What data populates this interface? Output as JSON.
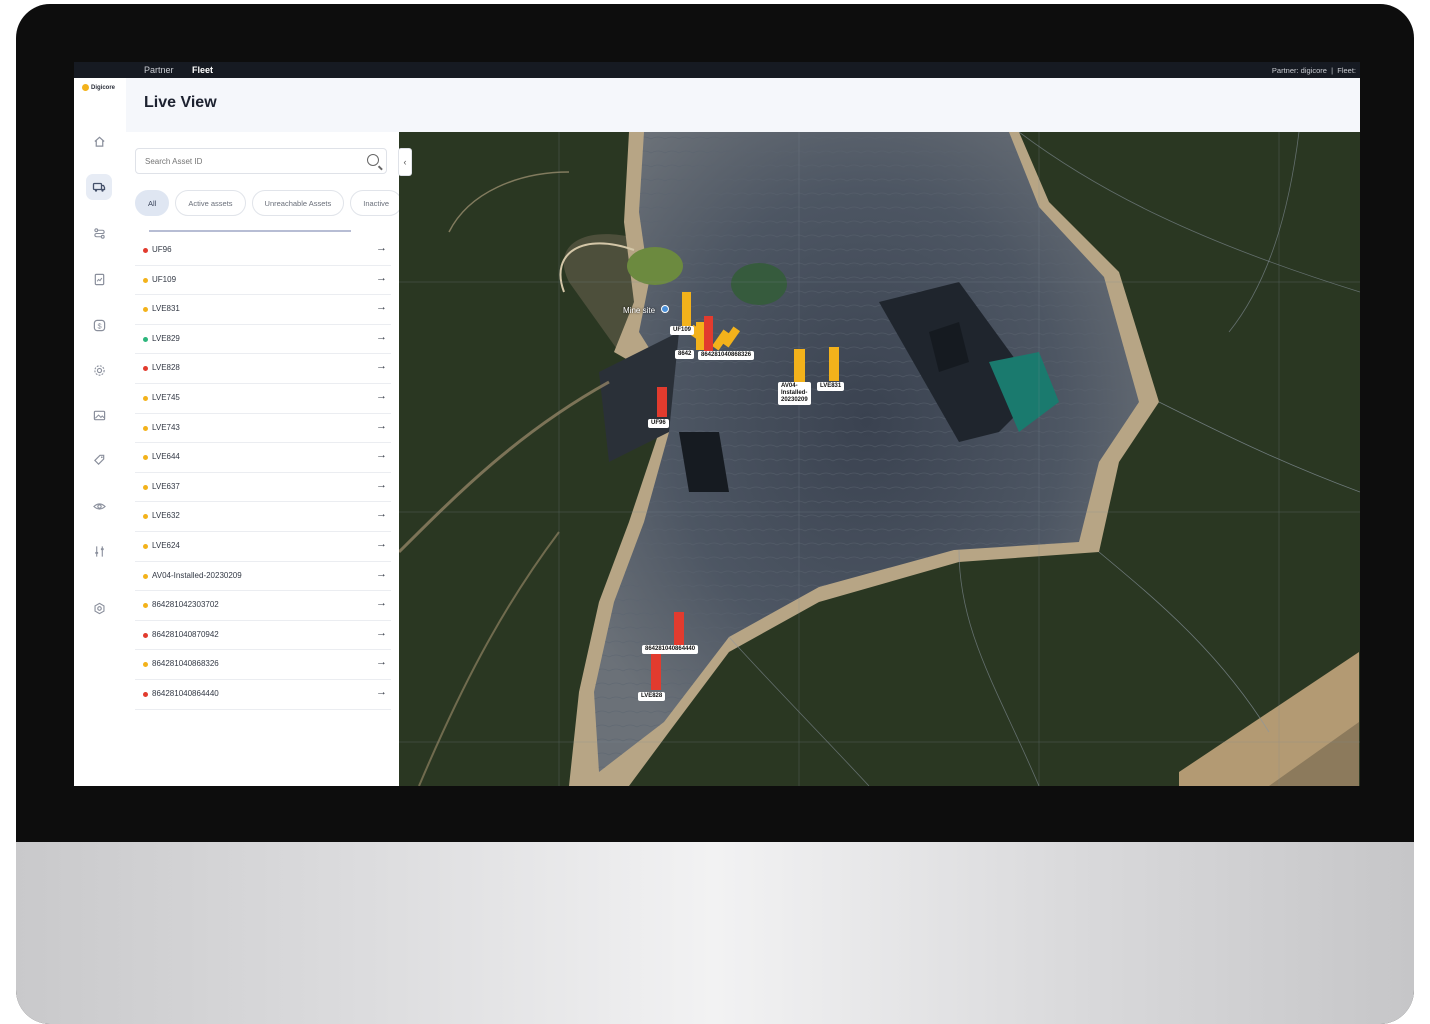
{
  "topbar": {
    "partner_tab": "Partner",
    "fleet_tab": "Fleet",
    "right_text": "Partner: digicore  |  Fleet:"
  },
  "brand": {
    "logo_text": "Digicore"
  },
  "header": {
    "title": "Live View"
  },
  "sidebar": {
    "icons": [
      "home-icon",
      "vehicle-icon",
      "route-icon",
      "report-icon",
      "dollar-icon",
      "settings-cog-icon",
      "image-icon",
      "tag-icon",
      "eye-icon",
      "sliders-icon",
      "gear-icon"
    ]
  },
  "search": {
    "placeholder": "Search Asset ID",
    "value": ""
  },
  "filters": [
    {
      "label": "All",
      "selected": true
    },
    {
      "label": "Active assets",
      "selected": false
    },
    {
      "label": "Unreachable Assets",
      "selected": false
    },
    {
      "label": "Inactive",
      "selected": false
    }
  ],
  "assets": [
    {
      "id": "UF96",
      "status_color": "#e23b2e"
    },
    {
      "id": "UF109",
      "status_color": "#f3b21b"
    },
    {
      "id": "LVE831",
      "status_color": "#f3b21b"
    },
    {
      "id": "LVE829",
      "status_color": "#2db67c"
    },
    {
      "id": "LVE828",
      "status_color": "#e23b2e"
    },
    {
      "id": "LVE745",
      "status_color": "#f3b21b"
    },
    {
      "id": "LVE743",
      "status_color": "#f3b21b"
    },
    {
      "id": "LVE644",
      "status_color": "#f3b21b"
    },
    {
      "id": "LVE637",
      "status_color": "#f3b21b"
    },
    {
      "id": "LVE632",
      "status_color": "#f3b21b"
    },
    {
      "id": "LVE624",
      "status_color": "#f3b21b"
    },
    {
      "id": "AV04-Installed-20230209",
      "status_color": "#f3b21b"
    },
    {
      "id": "864281042303702",
      "status_color": "#f3b21b"
    },
    {
      "id": "864281040870942",
      "status_color": "#e23b2e"
    },
    {
      "id": "864281040868326",
      "status_color": "#f3b21b"
    },
    {
      "id": "864281040864440",
      "status_color": "#e23b2e"
    }
  ],
  "map": {
    "place_label": "Mine site",
    "markers": [
      {
        "label": "UF109",
        "color": "#f3b21b"
      },
      {
        "label": "8642",
        "color": "#f3b21b"
      },
      {
        "label": "864281040868326",
        "color": "#e23b2e"
      },
      {
        "label": "AV04-\nInstalled-\n20230209",
        "color": "#f3b21b"
      },
      {
        "label": "LVE831",
        "color": "#f3b21b"
      },
      {
        "label": "UF96",
        "color": "#e23b2e"
      },
      {
        "label": "864281040864440",
        "color": "#e23b2e"
      },
      {
        "label": "LVE828",
        "color": "#e23b2e"
      }
    ]
  }
}
